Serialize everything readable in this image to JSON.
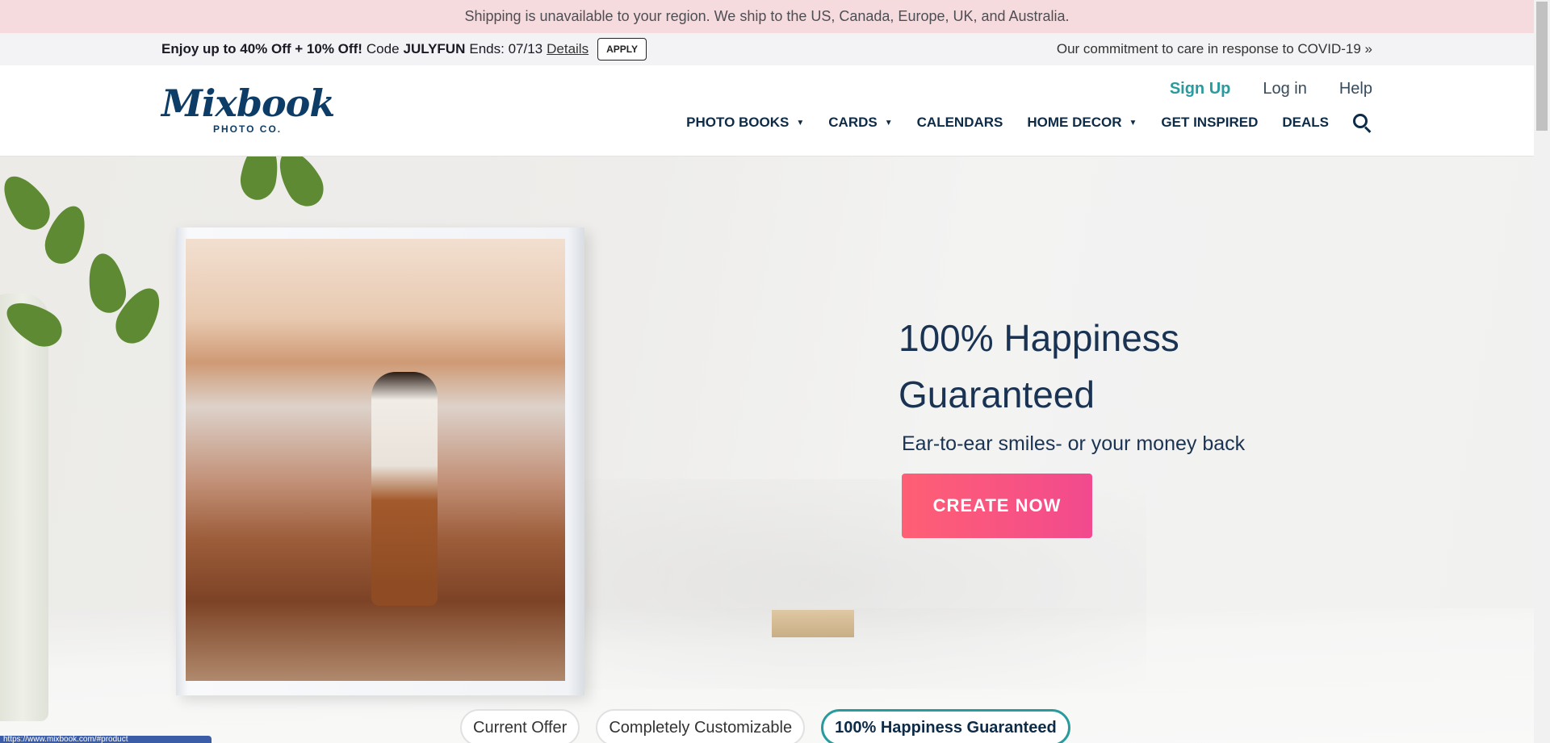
{
  "shipping_notice": "Shipping is unavailable to your region. We ship to the US, Canada, Europe, UK, and Australia.",
  "promo": {
    "offer_pre": "Enjoy up to 40% Off + 10% Off!",
    "code_label": "Code",
    "code": "JULYFUN",
    "ends": "Ends: 07/13",
    "details": "Details",
    "apply": "APPLY",
    "covid": "Our commitment to care in response to COVID-19 »"
  },
  "brand": {
    "logo_main": "Mixbook",
    "logo_sub": "PHOTO CO."
  },
  "header": {
    "sign_up": "Sign Up",
    "log_in": "Log in",
    "help": "Help"
  },
  "nav": {
    "items": [
      {
        "label": "PHOTO BOOKS"
      },
      {
        "label": "CARDS"
      },
      {
        "label": "CALENDARS"
      },
      {
        "label": "HOME DECOR"
      },
      {
        "label": "GET INSPIRED"
      },
      {
        "label": "DEALS"
      }
    ]
  },
  "hero": {
    "title_line1": "100% Happiness",
    "title_line2": "Guaranteed",
    "subtitle": "Ear-to-ear smiles- or your money back",
    "cta": "CREATE NOW"
  },
  "pills": [
    {
      "label": "Current Offer"
    },
    {
      "label": "Completely Customizable"
    },
    {
      "label": "100% Happiness Guaranteed"
    }
  ],
  "status_url": "https://www.mixbook.com/#product",
  "colors": {
    "accent_teal": "#2a9b9d",
    "navy": "#0d2b47",
    "cta_pink": "#f24a8e",
    "banner_pink": "#f5dbdd"
  }
}
